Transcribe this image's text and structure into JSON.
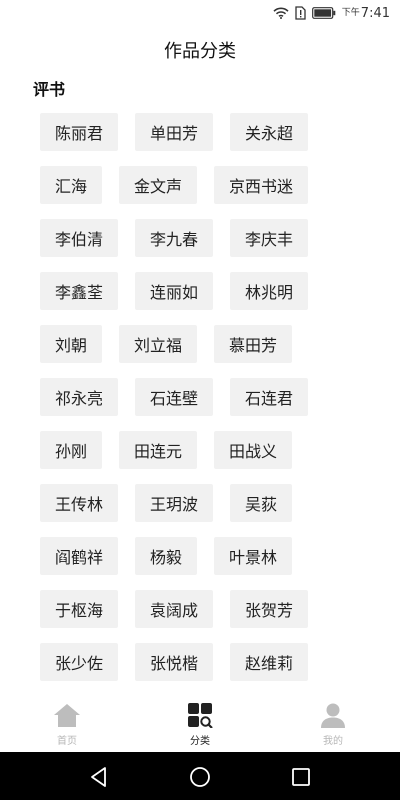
{
  "status_bar": {
    "ampm": "下午",
    "time": "7:41",
    "icons": [
      "wifi-icon",
      "sim-alert-icon",
      "battery-icon"
    ]
  },
  "header": {
    "title": "作品分类"
  },
  "section": {
    "title": "评书",
    "rows": [
      [
        "陈丽君",
        "单田芳",
        "关永超"
      ],
      [
        "汇海",
        "金文声",
        "京西书迷"
      ],
      [
        "李伯清",
        "李九春",
        "李庆丰"
      ],
      [
        "李鑫荃",
        "连丽如",
        "林兆明"
      ],
      [
        "刘朝",
        "刘立福",
        "慕田芳"
      ],
      [
        "祁永亮",
        "石连壁",
        "石连君"
      ],
      [
        "孙刚",
        "田连元",
        "田战义"
      ],
      [
        "王传林",
        "王玥波",
        "吴荻"
      ],
      [
        "阎鹤祥",
        "杨毅",
        "叶景林"
      ],
      [
        "于枢海",
        "袁阔成",
        "张贺芳"
      ],
      [
        "张少佐",
        "张悦楷",
        "赵维莉"
      ]
    ]
  },
  "tab_bar": {
    "tabs": [
      {
        "label": "首页",
        "icon": "home-icon",
        "active": false
      },
      {
        "label": "分类",
        "icon": "category-search-icon",
        "active": true
      },
      {
        "label": "我的",
        "icon": "user-icon",
        "active": false
      }
    ]
  },
  "nav_bar": {
    "icons": [
      "back-icon",
      "home-circle-icon",
      "recents-icon"
    ]
  },
  "colors": {
    "chip_bg": "#f1f1f1",
    "inactive_tab": "#b7b7b7",
    "active_tab": "#222222",
    "nav_bg": "#000000"
  }
}
